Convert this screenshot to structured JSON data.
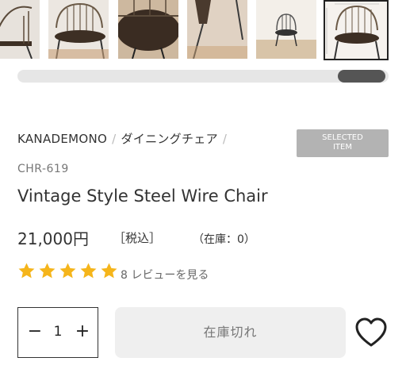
{
  "gallery": {
    "items": [
      "chair-front",
      "chair-front-light",
      "chair-seat-top",
      "chair-legs-closeup",
      "chair-room",
      "chair-dimensions"
    ],
    "selected_index": 5,
    "scroll_position": 1.0
  },
  "breadcrumb": {
    "brand": "KANADEMONO",
    "category": "ダイニングチェア",
    "separator": "/"
  },
  "badge": {
    "line1": "SELECTED",
    "line2": "ITEM"
  },
  "product": {
    "sku": "CHR-619",
    "title": "Vintage Style Steel Wire Chair",
    "price": "21,000円",
    "tax_label": "［税込］",
    "stock_label": "（在庫：0）"
  },
  "rating": {
    "stars": 5,
    "max": 5,
    "review_count": "8",
    "review_link": "レビューを見る",
    "star_color": "#f5b51b"
  },
  "quantity": {
    "minus": "−",
    "value": "1",
    "plus": "+"
  },
  "cart_button": {
    "label": "在庫切れ"
  },
  "favorite": {
    "icon": "heart-outline-icon"
  }
}
